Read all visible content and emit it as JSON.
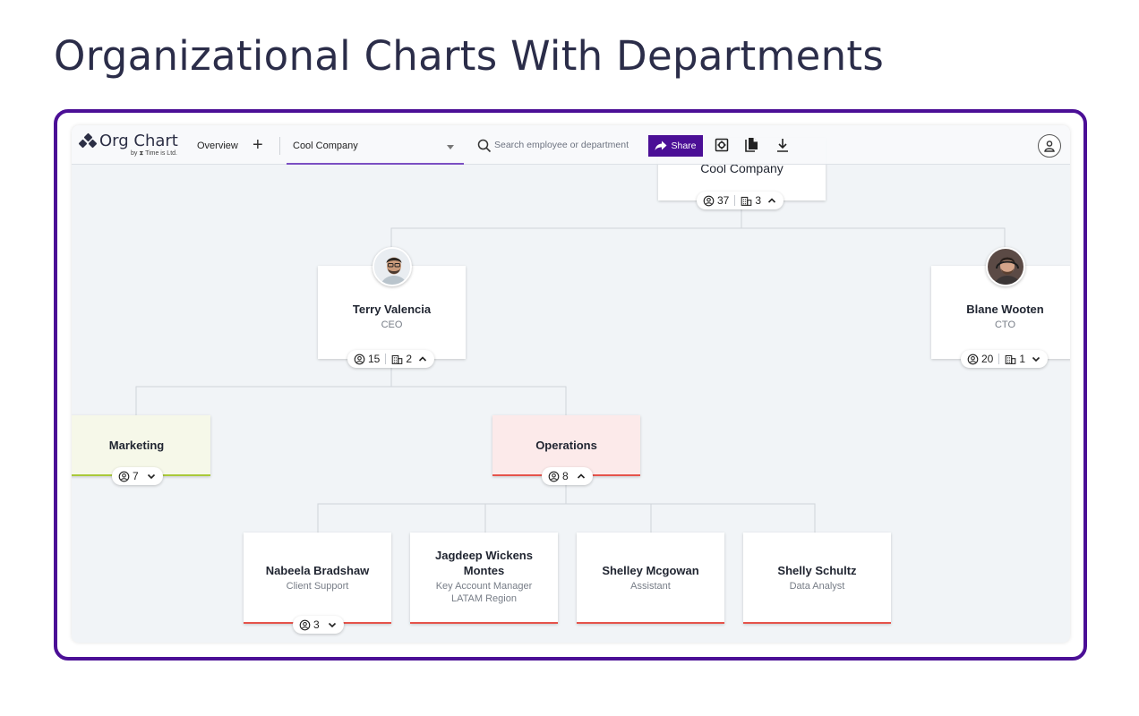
{
  "page": {
    "title": "Organizational Charts With Departments"
  },
  "app": {
    "logo": {
      "name": "Org Chart",
      "byline": "by ⧗ Time is Ltd."
    },
    "toolbar": {
      "overview_label": "Overview",
      "add_label": "+",
      "company_select": "Cool Company",
      "search_placeholder": "Search employee or department",
      "share_label": "Share"
    },
    "icons": {
      "logo": "diamond-dots-icon",
      "add": "plus-icon",
      "dropdown": "caret-down-icon",
      "search": "search-icon",
      "share": "share-arrow-icon",
      "settings": "gear-icon",
      "copy": "copy-document-icon",
      "download": "download-icon",
      "user": "user-avatar-icon",
      "people": "people-icon",
      "departments": "building-icon"
    },
    "colors": {
      "accent": "#4b0f96",
      "marketing_bg": "#f6f8e9",
      "marketing_line": "#a9c93a",
      "operations_bg": "#fceaea",
      "operations_line": "#e5534b"
    }
  },
  "chart": {
    "root": {
      "name": "Cool Company",
      "people": "37",
      "departments": "3",
      "expanded": true
    },
    "ceo": {
      "name": "Terry Valencia",
      "role": "CEO",
      "people": "15",
      "departments": "2",
      "expanded": true
    },
    "cto": {
      "name": "Blane Wooten",
      "role": "CTO",
      "people": "20",
      "departments": "1",
      "expanded": false
    },
    "marketing": {
      "name": "Marketing",
      "people": "7",
      "expanded": false
    },
    "operations": {
      "name": "Operations",
      "people": "8",
      "expanded": true
    },
    "employees": [
      {
        "name": "Nabeela Bradshaw",
        "role": "Client Support",
        "people": "3"
      },
      {
        "name": "Jagdeep Wickens Montes",
        "role": "Key Account Manager LATAM Region"
      },
      {
        "name": "Shelley Mcgowan",
        "role": "Assistant"
      },
      {
        "name": "Shelly Schultz",
        "role": "Data Analyst"
      }
    ]
  }
}
